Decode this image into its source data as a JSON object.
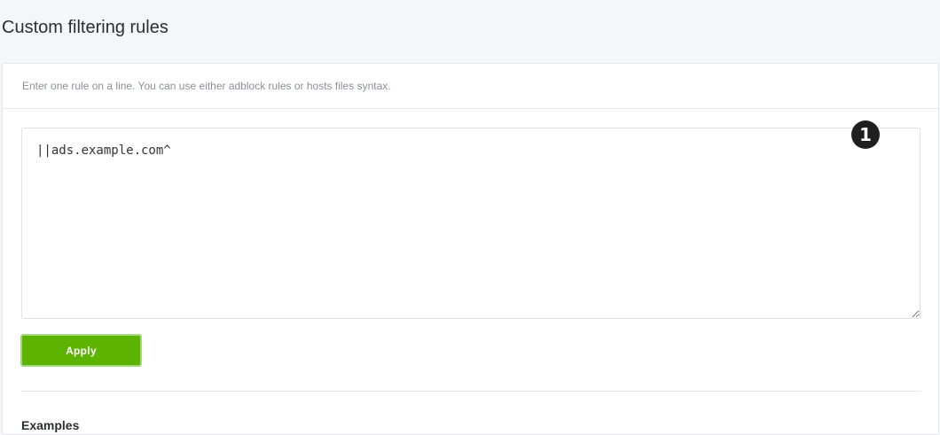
{
  "page": {
    "title": "Custom filtering rules"
  },
  "card": {
    "subtitle": "Enter one rule on a line. You can use either adblock rules or hosts files syntax.",
    "rules_text": "||ads.example.com^",
    "step_badge": "1",
    "apply_label": "Apply",
    "next_section_heading": "Examples"
  },
  "colors": {
    "apply_button": "#5cb300",
    "badge": "#1f1f1f",
    "background": "#f4f6fa"
  }
}
